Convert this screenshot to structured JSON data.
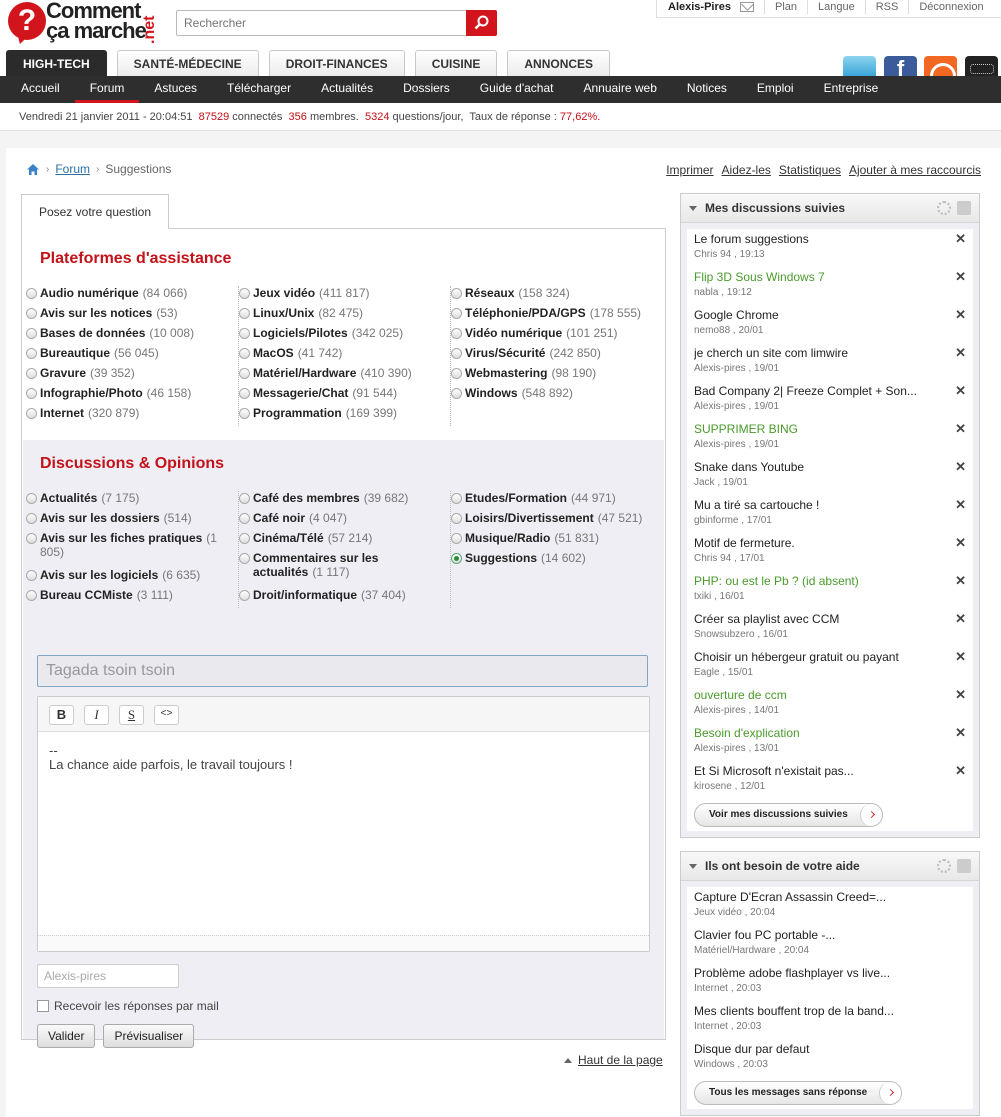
{
  "header": {
    "logo_line1": "Comment",
    "logo_line2": "ça marche",
    "logo_net": ".net",
    "search_placeholder": "Rechercher",
    "user": "Alexis-Pires",
    "user_links": [
      "Plan",
      "Langue",
      "RSS",
      "Déconnexion"
    ],
    "category_tabs": [
      "HIGH-TECH",
      "SANTÉ-MÉDECINE",
      "DROIT-FINANCES",
      "CUISINE",
      "ANNONCES"
    ],
    "active_category": "HIGH-TECH",
    "subnav": [
      "Accueil",
      "Forum",
      "Astuces",
      "Télécharger",
      "Actualités",
      "Dossiers",
      "Guide d'achat",
      "Annuaire web",
      "Notices",
      "Emploi",
      "Entreprise"
    ],
    "active_subnav": "Forum"
  },
  "stats": {
    "date": "Vendredi 21 janvier 2011 - 20:04:51",
    "connected": "87529",
    "connected_label": "connectés",
    "members": "356",
    "members_label": "membres.",
    "questions": "5324",
    "questions_label": "questions/jour,",
    "rate_label": "Taux de réponse :",
    "rate": "77,62%."
  },
  "breadcrumb": {
    "forum": "Forum",
    "current": "Suggestions"
  },
  "toplinks": [
    "Imprimer",
    "Aidez-les",
    "Statistiques",
    "Ajouter à mes raccourcis"
  ],
  "main": {
    "tab": "Posez votre question",
    "section1_title": "Plateformes d'assistance",
    "section1": [
      [
        {
          "name": "Audio numérique",
          "count": "(84 066)"
        },
        {
          "name": "Avis sur les notices",
          "count": "(53)"
        },
        {
          "name": "Bases de données",
          "count": "(10 008)"
        },
        {
          "name": "Bureautique",
          "count": "(56 045)"
        },
        {
          "name": "Gravure",
          "count": "(39 352)"
        },
        {
          "name": "Infographie/Photo",
          "count": "(46 158)"
        },
        {
          "name": "Internet",
          "count": "(320 879)"
        }
      ],
      [
        {
          "name": "Jeux vidéo",
          "count": "(411 817)"
        },
        {
          "name": "Linux/Unix",
          "count": "(82 475)"
        },
        {
          "name": "Logiciels/Pilotes",
          "count": "(342 025)"
        },
        {
          "name": "MacOS",
          "count": "(41 742)"
        },
        {
          "name": "Matériel/Hardware",
          "count": "(410 390)"
        },
        {
          "name": "Messagerie/Chat",
          "count": "(91 544)"
        },
        {
          "name": "Programmation",
          "count": "(169 399)"
        }
      ],
      [
        {
          "name": "Réseaux",
          "count": "(158 324)"
        },
        {
          "name": "Téléphonie/PDA/GPS",
          "count": "(178 555)"
        },
        {
          "name": "Vidéo numérique",
          "count": "(101 251)"
        },
        {
          "name": "Virus/Sécurité",
          "count": "(242 850)"
        },
        {
          "name": "Webmastering",
          "count": "(98 190)"
        },
        {
          "name": "Windows",
          "count": "(548 892)"
        }
      ]
    ],
    "section2_title": "Discussions & Opinions",
    "section2": [
      [
        {
          "name": "Actualités",
          "count": "(7 175)"
        },
        {
          "name": "Avis sur les dossiers",
          "count": "(514)"
        },
        {
          "name": "Avis sur les fiches pratiques",
          "count": "(1 805)"
        },
        {
          "name": "Avis sur les logiciels",
          "count": "(6 635)"
        },
        {
          "name": "Bureau CCMiste",
          "count": "(3 111)"
        }
      ],
      [
        {
          "name": "Café des membres",
          "count": "(39 682)"
        },
        {
          "name": "Café noir",
          "count": "(4 047)"
        },
        {
          "name": "Cinéma/Télé",
          "count": "(57 214)"
        },
        {
          "name": "Commentaires sur les actualités",
          "count": "(1 117)"
        },
        {
          "name": "Droit/informatique",
          "count": "(37 404)"
        }
      ],
      [
        {
          "name": "Etudes/Formation",
          "count": "(44 971)"
        },
        {
          "name": "Loisirs/Divertissement",
          "count": "(47 521)"
        },
        {
          "name": "Musique/Radio",
          "count": "(51 831)"
        },
        {
          "name": "Suggestions",
          "count": "(14 602)"
        }
      ]
    ],
    "selected_category": "Suggestions",
    "title_value": "Tagada tsoin tsoin",
    "editor_buttons": [
      "B",
      "I",
      "S",
      "<>"
    ],
    "editor_text": "--\nLa chance aide parfois, le travail toujours !",
    "author_placeholder": "Alexis-pires",
    "checkbox_label": "Recevoir les réponses par mail",
    "btn_submit": "Valider",
    "btn_preview": "Prévisualiser",
    "back_top": "Haut de la page"
  },
  "followed": {
    "title": "Mes discussions suivies",
    "items": [
      {
        "title": "Le forum suggestions",
        "meta": "Chris 94 , 19:13",
        "green": false
      },
      {
        "title": "Flip 3D Sous Windows 7",
        "meta": "nabla , 19:12",
        "green": true
      },
      {
        "title": "Google Chrome",
        "meta": "nemo88 , 20/01",
        "green": false
      },
      {
        "title": "je cherch un site com limwire",
        "meta": "Alexis-pires , 19/01",
        "green": false
      },
      {
        "title": "Bad Company 2| Freeze Complet + Son...",
        "meta": "Alexis-pires , 19/01",
        "green": false
      },
      {
        "title": "SUPPRIMER BING",
        "meta": "Alexis-pires , 19/01",
        "green": true
      },
      {
        "title": "Snake dans Youtube",
        "meta": "Jack , 19/01",
        "green": false
      },
      {
        "title": "Mu a tiré sa cartouche !",
        "meta": "gbinforme , 17/01",
        "green": false
      },
      {
        "title": "Motif de fermeture.",
        "meta": "Chris 94 , 17/01",
        "green": false
      },
      {
        "title": "PHP: ou est le Pb ? (id absent)",
        "meta": "txiki , 16/01",
        "green": true
      },
      {
        "title": "Créer sa playlist avec CCM",
        "meta": "Snowsubzero , 16/01",
        "green": false
      },
      {
        "title": "Choisir un hébergeur gratuit ou payant",
        "meta": "Eagle , 15/01",
        "green": false
      },
      {
        "title": "ouverture de ccm",
        "meta": "Alexis-pires , 14/01",
        "green": true
      },
      {
        "title": "Besoin d'explication",
        "meta": "Alexis-pires , 13/01",
        "green": true
      },
      {
        "title": "Et Si Microsoft n'existait pas...",
        "meta": "kirosene , 12/01",
        "green": false
      }
    ],
    "more": "Voir mes discussions suivies"
  },
  "needhelp": {
    "title": "Ils ont besoin de votre aide",
    "items": [
      {
        "title": "Capture D'Ecran Assassin Creed=...",
        "meta": "Jeux vidéo , 20:04"
      },
      {
        "title": "Clavier fou PC portable -...",
        "meta": "Matériel/Hardware , 20:04"
      },
      {
        "title": "Problème adobe flashplayer vs live...",
        "meta": "Internet , 20:03"
      },
      {
        "title": "Mes clients bouffent trop de la band...",
        "meta": "Internet , 20:03"
      },
      {
        "title": "Disque dur par defaut",
        "meta": "Windows , 20:03"
      }
    ],
    "more": "Tous les messages sans réponse"
  }
}
